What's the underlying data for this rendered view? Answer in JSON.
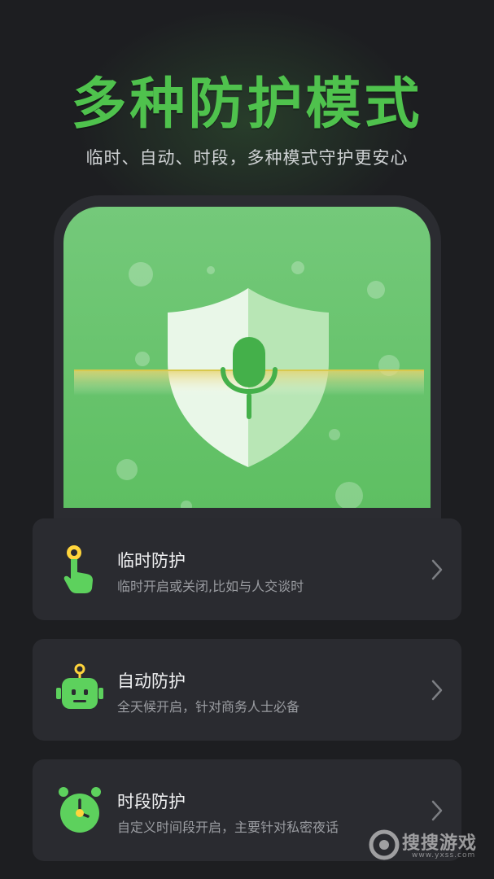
{
  "header": {
    "title": "多种防护模式",
    "subtitle": "临时、自动、时段，多种模式守护更安心"
  },
  "illustration": {
    "icon": "shield-microphone-icon"
  },
  "modes": [
    {
      "title": "临时防护",
      "desc": "临时开启或关闭,比如与人交谈时",
      "icon": "tap-hand-icon"
    },
    {
      "title": "自动防护",
      "desc": "全天候开启，针对商务人士必备",
      "icon": "robot-icon"
    },
    {
      "title": "时段防护",
      "desc": "自定义时间段开启，主要针对私密夜话",
      "icon": "alarm-clock-icon"
    }
  ],
  "watermark": {
    "text": "搜搜游戏",
    "sub": "www.yxss.com"
  },
  "colors": {
    "accent": "#4fc24d",
    "background": "#1d1e21",
    "card": "#2a2b30"
  }
}
